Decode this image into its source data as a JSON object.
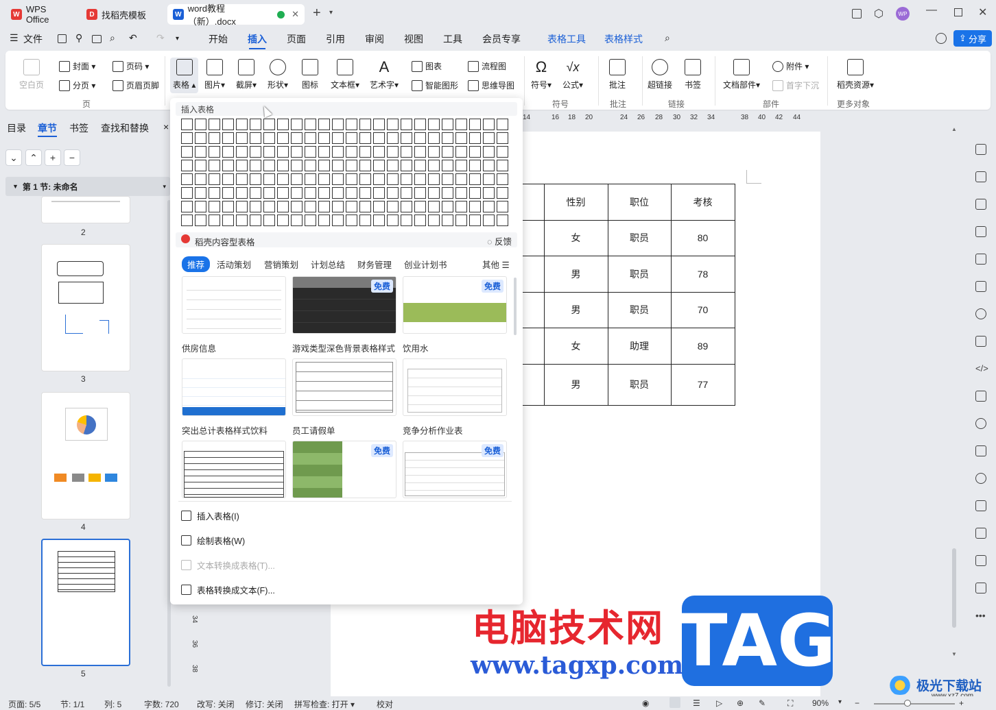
{
  "titlebar": {
    "tabs": [
      {
        "label": "WPS Office",
        "icon": "wps-logo-icon"
      },
      {
        "label": "找稻壳模板",
        "icon": "docer-icon"
      },
      {
        "label": "word教程（新）.docx",
        "icon": "word-doc-icon",
        "active": true
      }
    ],
    "add_tab": "+",
    "avatar": "WP"
  },
  "menubar": {
    "file": "文件",
    "items": [
      "开始",
      "插入",
      "页面",
      "引用",
      "审阅",
      "视图",
      "工具",
      "会员专享"
    ],
    "active": "插入",
    "context_items": [
      "表格工具",
      "表格样式"
    ],
    "share": "分享"
  },
  "ribbon": {
    "blank_page": "空白页",
    "cover": "封面",
    "page_break": "分页",
    "page_number": "页码",
    "header_footer": "页眉页脚",
    "group_page": "页",
    "table": "表格",
    "picture": "图片",
    "screenshot": "截屏",
    "shape": "形状",
    "icon": "图标",
    "textbox": "文本框",
    "wordart": "艺术字",
    "chart": "图表",
    "smart_shape": "智能图形",
    "flowchart": "流程图",
    "mindmap": "思维导图",
    "symbol": "符号",
    "formula": "公式",
    "group_symbol": "符号",
    "comment": "批注",
    "group_comment": "批注",
    "hyperlink": "超链接",
    "bookmark": "书签",
    "group_link": "链接",
    "attachment": "附件",
    "doc_parts": "文档部件",
    "drop_cap": "首字下沉",
    "group_parts": "部件",
    "docer_resources": "稻壳资源",
    "group_more": "更多对象"
  },
  "left_panel": {
    "tabs": [
      "目录",
      "章节",
      "书签",
      "查找和替换"
    ],
    "active_tab": "章节",
    "close": "×",
    "section_title": "第 1 节: 未命名",
    "pages": [
      "2",
      "3",
      "4",
      "5"
    ]
  },
  "ruler": {
    "ticks": [
      "14",
      "16",
      "18",
      "20",
      "24",
      "26",
      "28",
      "30",
      "32",
      "34",
      "38",
      "40",
      "42",
      "44"
    ],
    "vticks": [
      "34",
      "36",
      "38"
    ]
  },
  "doc_table": {
    "headers": [
      "性别",
      "职位",
      "考核"
    ],
    "rows": [
      [
        "女",
        "职员",
        "80"
      ],
      [
        "男",
        "职员",
        "78"
      ],
      [
        "男",
        "职员",
        "70"
      ],
      [
        "女",
        "助理",
        "89"
      ],
      [
        "男",
        "职员",
        "77"
      ]
    ]
  },
  "dropdown": {
    "title": "插入表格",
    "grid_cols": 24,
    "grid_rows": 8,
    "docer_title": "稻壳内容型表格",
    "feedback": "反馈",
    "categories": [
      "推荐",
      "活动策划",
      "营销策划",
      "计划总结",
      "财务管理",
      "创业计划书"
    ],
    "more": "其他",
    "free_badge": "免费",
    "templates": [
      {
        "label": "供房信息",
        "free": false
      },
      {
        "label": "游戏类型深色背景表格样式",
        "free": true
      },
      {
        "label": "饮用水",
        "free": true
      },
      {
        "label": "突出总计表格样式饮料",
        "free": false
      },
      {
        "label": "员工请假单",
        "free": false
      },
      {
        "label": "竞争分析作业表",
        "free": false
      },
      {
        "label": "",
        "free": false
      },
      {
        "label": "",
        "free": true
      },
      {
        "label": "",
        "free": true
      }
    ],
    "actions": [
      {
        "label": "插入表格(I)",
        "enabled": true
      },
      {
        "label": "绘制表格(W)",
        "enabled": true
      },
      {
        "label": "文本转换成表格(T)...",
        "enabled": false
      },
      {
        "label": "表格转换成文本(F)...",
        "enabled": true
      }
    ]
  },
  "statusbar": {
    "page": "页面: 5/5",
    "section": "节: 1/1",
    "col": "列: 5",
    "words": "字数: 720",
    "overtype": "改写: 关闭",
    "revision": "修订: 关闭",
    "spellcheck": "拼写检查: 打开",
    "proof": "校对",
    "zoom": "90%"
  },
  "watermark": {
    "line1": "电脑技术网",
    "line2": "www.tagxp.com",
    "tag": "TAG",
    "site": "极光下载站",
    "site_url": "www.xz7.com"
  },
  "colors": {
    "accent": "#1a5fd6",
    "watermark_red": "#e6262e",
    "tag_blue": "#1f6fe0"
  }
}
